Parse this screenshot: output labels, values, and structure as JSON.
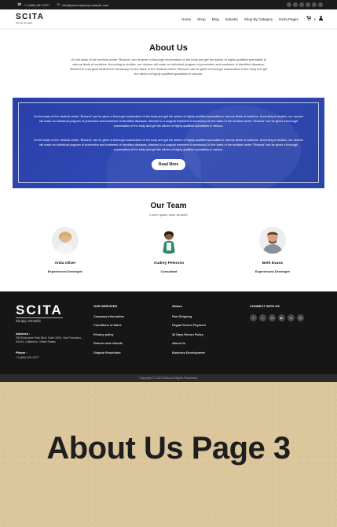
{
  "topbar": {
    "phone": "+1 (650) 691 0277",
    "email": "info@yourcompany.example.com"
  },
  "header": {
    "logo": "SCITA",
    "tagline": "Simply Versatile",
    "nav": [
      "Home",
      "Shop",
      "Blog",
      "Industry",
      "Shop By Category",
      "Extra Pages"
    ],
    "cart_count": "0"
  },
  "about": {
    "title": "About Us",
    "text": "On the basis of the medical center \"Briosna\" can be given a thorough examination of the body and get the advice of highly qualified specialists in various fields of medicine. According to studies, our doctors will make an individual program of prevention and treatment of identified diseases, directed to a surgical treatment if necessary.On the basis of the medical center \"Briosna\" can be given a thorough examination of the body and get the advice of highly qualified specialists in various."
  },
  "banner": {
    "p1": "On the basis of the medical center \"Briosna\" can be given a thorough examination of the body and get the advice of highly qualified specialists in various fields of medicine. According to studies, our doctors will make an individual program of prevention and treatment of identified diseases, directed to a surgical treatment if necessary.On the basis of the medical center \"Briosna\" can be given a thorough examination of the body and get the advice of highly qualified specialists in various.",
    "p2": "On the basis of the medical center \"Briosna\" can be given a thorough examination of the body and get the advice of highly qualified specialists in various fields of medicine. According to studies, our doctors will make an individual program of prevention and treatment of identified diseases, directed to a surgical treatment if necessary.On the basis of the medical center \"Briosna\" can be given a thorough examination of the body and get the advice of highly qualified specialists in various.",
    "button": "Read More"
  },
  "team": {
    "title": "Our Team",
    "subtitle": "Lorem ipsum dolor sit amet",
    "members": [
      {
        "name": "Anita Oliver",
        "role": "Experienced Developer"
      },
      {
        "name": "Audrey Peterson",
        "role": "Consultant"
      },
      {
        "name": "Beth Evans",
        "role": "Experienced Developer"
      }
    ]
  },
  "footer": {
    "logo": "SCITA",
    "tagline": "Simply Versatile",
    "address_label": "Address :",
    "address": "250 Executive Park Blvd, Suite 3400, San Francisco - 94134, California, United States",
    "phone_label": "Phone :",
    "phone": "+1 (650) 691 0277",
    "services_head": "OUR SERVICES",
    "services": [
      "Company Information",
      "Conditions of Sales",
      "Privacy policy",
      "Returns and refunds",
      "Dispute Resolution"
    ],
    "others_head": "Others",
    "others": [
      "Fast Shipping",
      "Paypal Secure Payment",
      "30 Days Return Policy",
      "About Us",
      "Business Development"
    ],
    "connect_head": "CONNECT WITH US",
    "social_icons": [
      "facebook-icon",
      "twitter-icon",
      "linkedin-icon",
      "youtube-icon",
      "github-icon",
      "instagram-icon"
    ],
    "copyright": "Copyright © 2019 Scita All Rights Reserved."
  },
  "caption": {
    "text": "About Us Page 3"
  },
  "colors": {
    "banner_blue": "#3049b5",
    "footer_bg": "#161616",
    "caption_bg": "#dcc69c"
  }
}
